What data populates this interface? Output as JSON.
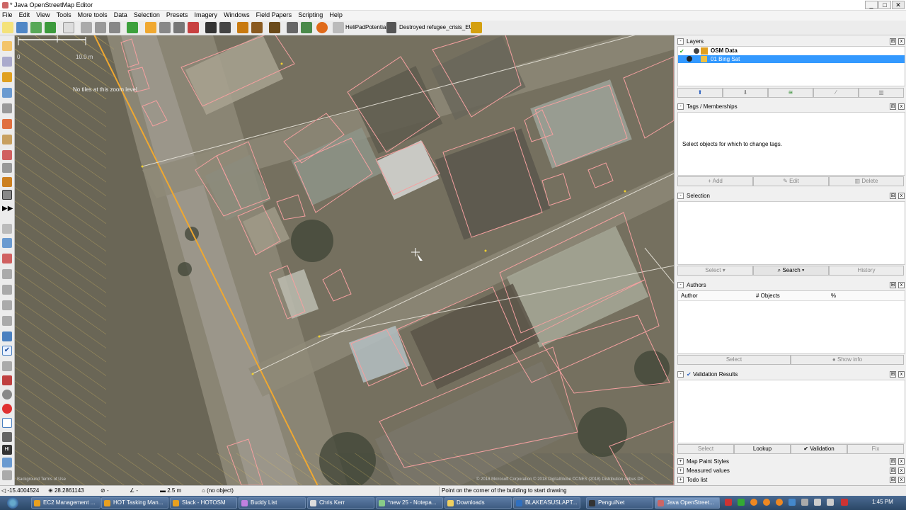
{
  "window": {
    "title": "* Java OpenStreetMap Editor",
    "controls": [
      "_",
      "□",
      "✕"
    ]
  },
  "menu": [
    "File",
    "Edit",
    "View",
    "Tools",
    "More tools",
    "Data",
    "Selection",
    "Presets",
    "Imagery",
    "Windows",
    "Field Papers",
    "Scripting",
    "Help"
  ],
  "toolbar": {
    "text_items": [
      "HeliPadPotential",
      "Destroyed",
      "refugee_crisis_EU"
    ]
  },
  "map": {
    "scale_label": "10.0 m",
    "scale_zero": "0",
    "no_tiles_text": "No tiles at this zoom level",
    "attribution": "© 2018 Microsoft Corporation © 2018 DigitalGlobe ©CNES (2018) Distribution Airbus DS",
    "bottom_left_text": "Background Terms of Use"
  },
  "layers": {
    "title": "Layers",
    "items": [
      {
        "name": "OSM Data",
        "selected": false
      },
      {
        "name": "01 Bing Sat",
        "selected": true
      }
    ]
  },
  "tags": {
    "title": "Tags / Memberships",
    "empty_text": "Select objects for which to change tags.",
    "add": "Add",
    "edit": "Edit",
    "delete": "Delete"
  },
  "selection": {
    "title": "Selection",
    "select": "Select",
    "search": "Search",
    "history": "History"
  },
  "authors": {
    "title": "Authors",
    "columns": [
      "Author",
      "# Objects",
      "%"
    ],
    "select": "Select",
    "show_info": "Show info"
  },
  "validation": {
    "title": "Validation Results",
    "select": "Select",
    "lookup": "Lookup",
    "validation": "Validation",
    "fix": "Fix"
  },
  "collapsed_panels": [
    "Map Paint Styles",
    "Measured values",
    "Todo list"
  ],
  "status": {
    "lat": "-15.4004524",
    "lon": "28.2861143",
    "heading": "-",
    "angle": "-",
    "distance": "2.5 m",
    "object": "(no object)",
    "help": "Point on the corner of the building to start drawing"
  },
  "taskbar": {
    "tasks": [
      "EC2 Management ...",
      "HOT Tasking Man...",
      "Slack - HOTOSM",
      "Buddy List",
      "Chris Kerr",
      "*new 25 - Notepa...",
      "Downloads",
      "BLAKEASUSLAPT...",
      "PenguiNet",
      "Java OpenStreet..."
    ],
    "time": "1:45 PM"
  },
  "colors": {
    "selected_layer": "#3399ff",
    "road": "#f0a830",
    "building_outline": "#f5a0a0",
    "taskbar": "#2b4766"
  }
}
